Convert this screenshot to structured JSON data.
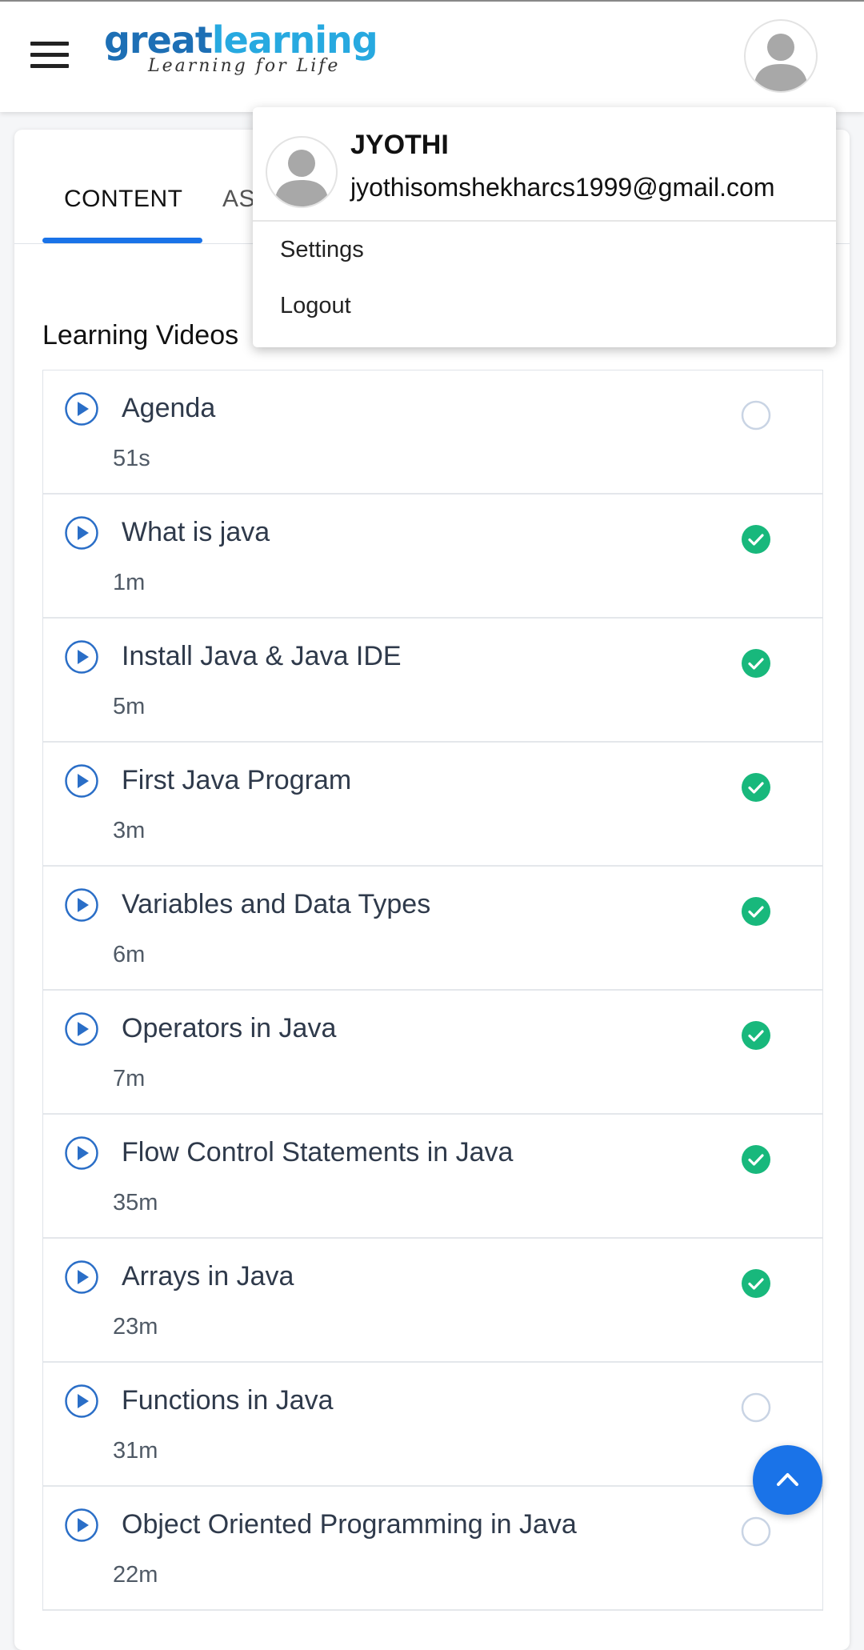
{
  "header": {
    "logo": {
      "brand_part1": "great",
      "brand_part2": "learning",
      "tagline": "Learning for Life"
    },
    "menu_icon": "hamburger-menu-icon",
    "avatar_icon": "user-avatar-icon"
  },
  "tabs": [
    {
      "label": "CONTENT",
      "active": true
    },
    {
      "label": "AS",
      "active": false
    }
  ],
  "section": {
    "title": "Learning Videos"
  },
  "videos": [
    {
      "title": "Agenda",
      "duration": "51s",
      "completed": false
    },
    {
      "title": "What is java",
      "duration": "1m",
      "completed": true
    },
    {
      "title": "Install Java & Java IDE",
      "duration": "5m",
      "completed": true
    },
    {
      "title": "First Java Program",
      "duration": "3m",
      "completed": true
    },
    {
      "title": "Variables and Data Types",
      "duration": "6m",
      "completed": true
    },
    {
      "title": "Operators in Java",
      "duration": "7m",
      "completed": true
    },
    {
      "title": "Flow Control Statements in Java",
      "duration": "35m",
      "completed": true
    },
    {
      "title": "Arrays in Java",
      "duration": "23m",
      "completed": true
    },
    {
      "title": "Functions in Java",
      "duration": "31m",
      "completed": false
    },
    {
      "title": "Object Oriented Programming in Java",
      "duration": "22m",
      "completed": false
    }
  ],
  "dropdown": {
    "name": "JYOTHI",
    "email": "jyothisomshekharcs1999@gmail.com",
    "settings_label": "Settings",
    "logout_label": "Logout"
  },
  "fab": {
    "icon": "chevron-up-icon"
  },
  "colors": {
    "accent": "#1a73e8",
    "completed": "#18b87c",
    "pending_ring": "#c9d4e4",
    "play_icon": "#2a6ec7"
  }
}
